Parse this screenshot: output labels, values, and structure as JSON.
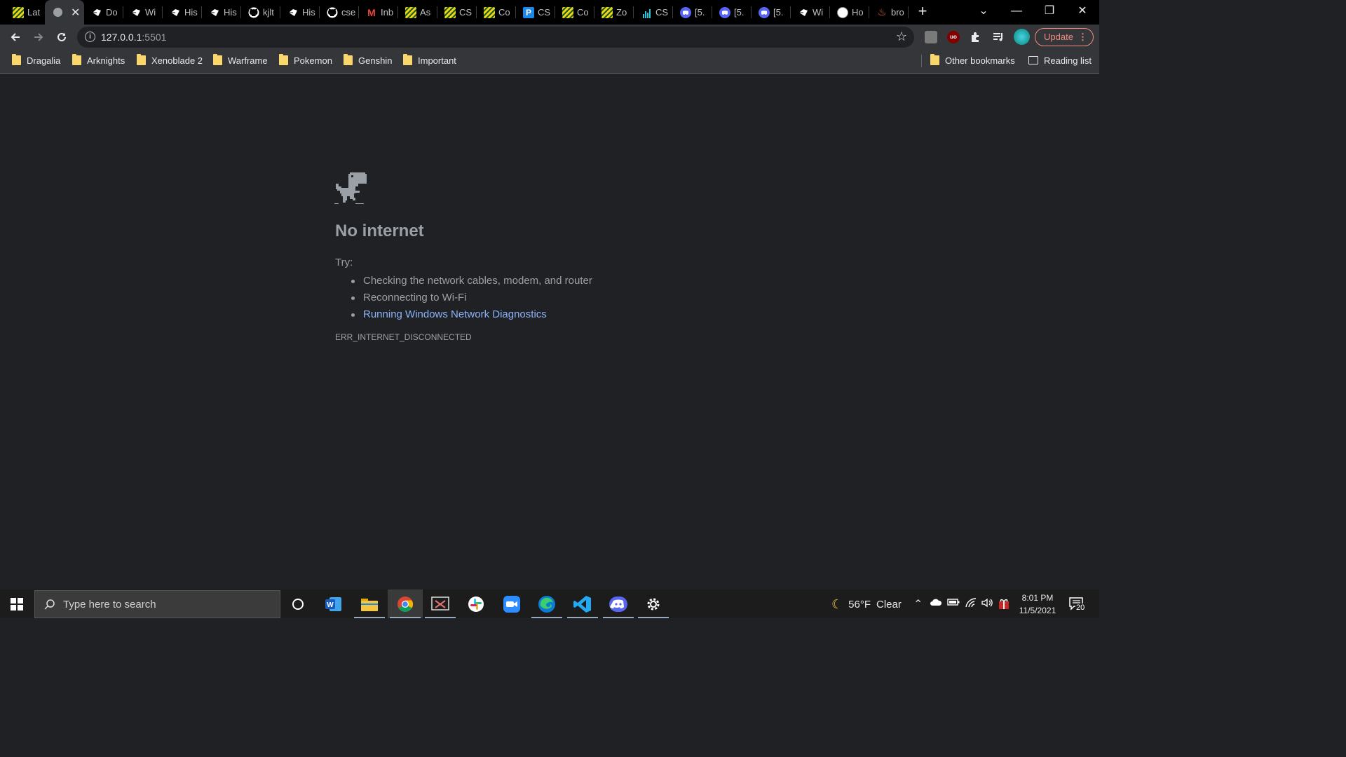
{
  "browser": {
    "tabs": [
      {
        "title": "Lat",
        "favicon": "stripe-icon"
      },
      {
        "title": "",
        "favicon": "loading-icon",
        "active": true
      },
      {
        "title": "Do",
        "favicon": "kite-icon"
      },
      {
        "title": "Wi",
        "favicon": "kite-icon"
      },
      {
        "title": "His",
        "favicon": "kite-icon"
      },
      {
        "title": "His",
        "favicon": "kite-icon"
      },
      {
        "title": "kjlt",
        "favicon": "github-icon"
      },
      {
        "title": "His",
        "favicon": "kite-icon"
      },
      {
        "title": "cse",
        "favicon": "github-icon"
      },
      {
        "title": "Inb",
        "favicon": "gmail-icon"
      },
      {
        "title": "As",
        "favicon": "stripe-icon"
      },
      {
        "title": "CS",
        "favicon": "stripe-icon"
      },
      {
        "title": "Co",
        "favicon": "stripe-icon"
      },
      {
        "title": "CS",
        "favicon": "p-icon"
      },
      {
        "title": "Co",
        "favicon": "stripe-icon"
      },
      {
        "title": "Zo",
        "favicon": "stripe-icon"
      },
      {
        "title": "CS",
        "favicon": "chart-icon"
      },
      {
        "title": "[5.",
        "favicon": "discord-icon"
      },
      {
        "title": "[5.",
        "favicon": "discord-icon"
      },
      {
        "title": "[5.",
        "favicon": "discord-icon"
      },
      {
        "title": "Wi",
        "favicon": "kite-icon"
      },
      {
        "title": "Ho",
        "favicon": "face-icon"
      },
      {
        "title": "bro",
        "favicon": "flame-icon"
      }
    ],
    "new_tab_symbol": "+",
    "window_controls": {
      "tab_search": "⌄",
      "minimize": "—",
      "restore": "❐",
      "close": "✕"
    },
    "address": {
      "host": "127.0.0.1",
      "port": ":5501"
    },
    "update_label": "Update",
    "bookmarks": [
      "Dragalia",
      "Arknights",
      "Xenoblade 2",
      "Warframe",
      "Pokemon",
      "Genshin",
      "Important"
    ],
    "other_bookmarks": "Other bookmarks",
    "reading_list": "Reading list"
  },
  "error_page": {
    "title": "No internet",
    "try_label": "Try:",
    "suggestions": [
      "Checking the network cables, modem, and router",
      "Reconnecting to Wi-Fi",
      "Running Windows Network Diagnostics"
    ],
    "error_code": "ERR_INTERNET_DISCONNECTED",
    "link_color": "#8ab4f8"
  },
  "taskbar": {
    "search_placeholder": "Type here to search",
    "apps": [
      "cortana-icon",
      "word-icon",
      "file-explorer-icon",
      "chrome-icon",
      "snipping-tool-icon",
      "slack-icon",
      "zoom-icon",
      "edge-icon",
      "vscode-icon",
      "discord-icon",
      "settings-icon"
    ],
    "weather": {
      "temp": "56°F",
      "condition": "Clear"
    },
    "time": "8:01 PM",
    "date": "11/5/2021",
    "notification_count": "20"
  }
}
